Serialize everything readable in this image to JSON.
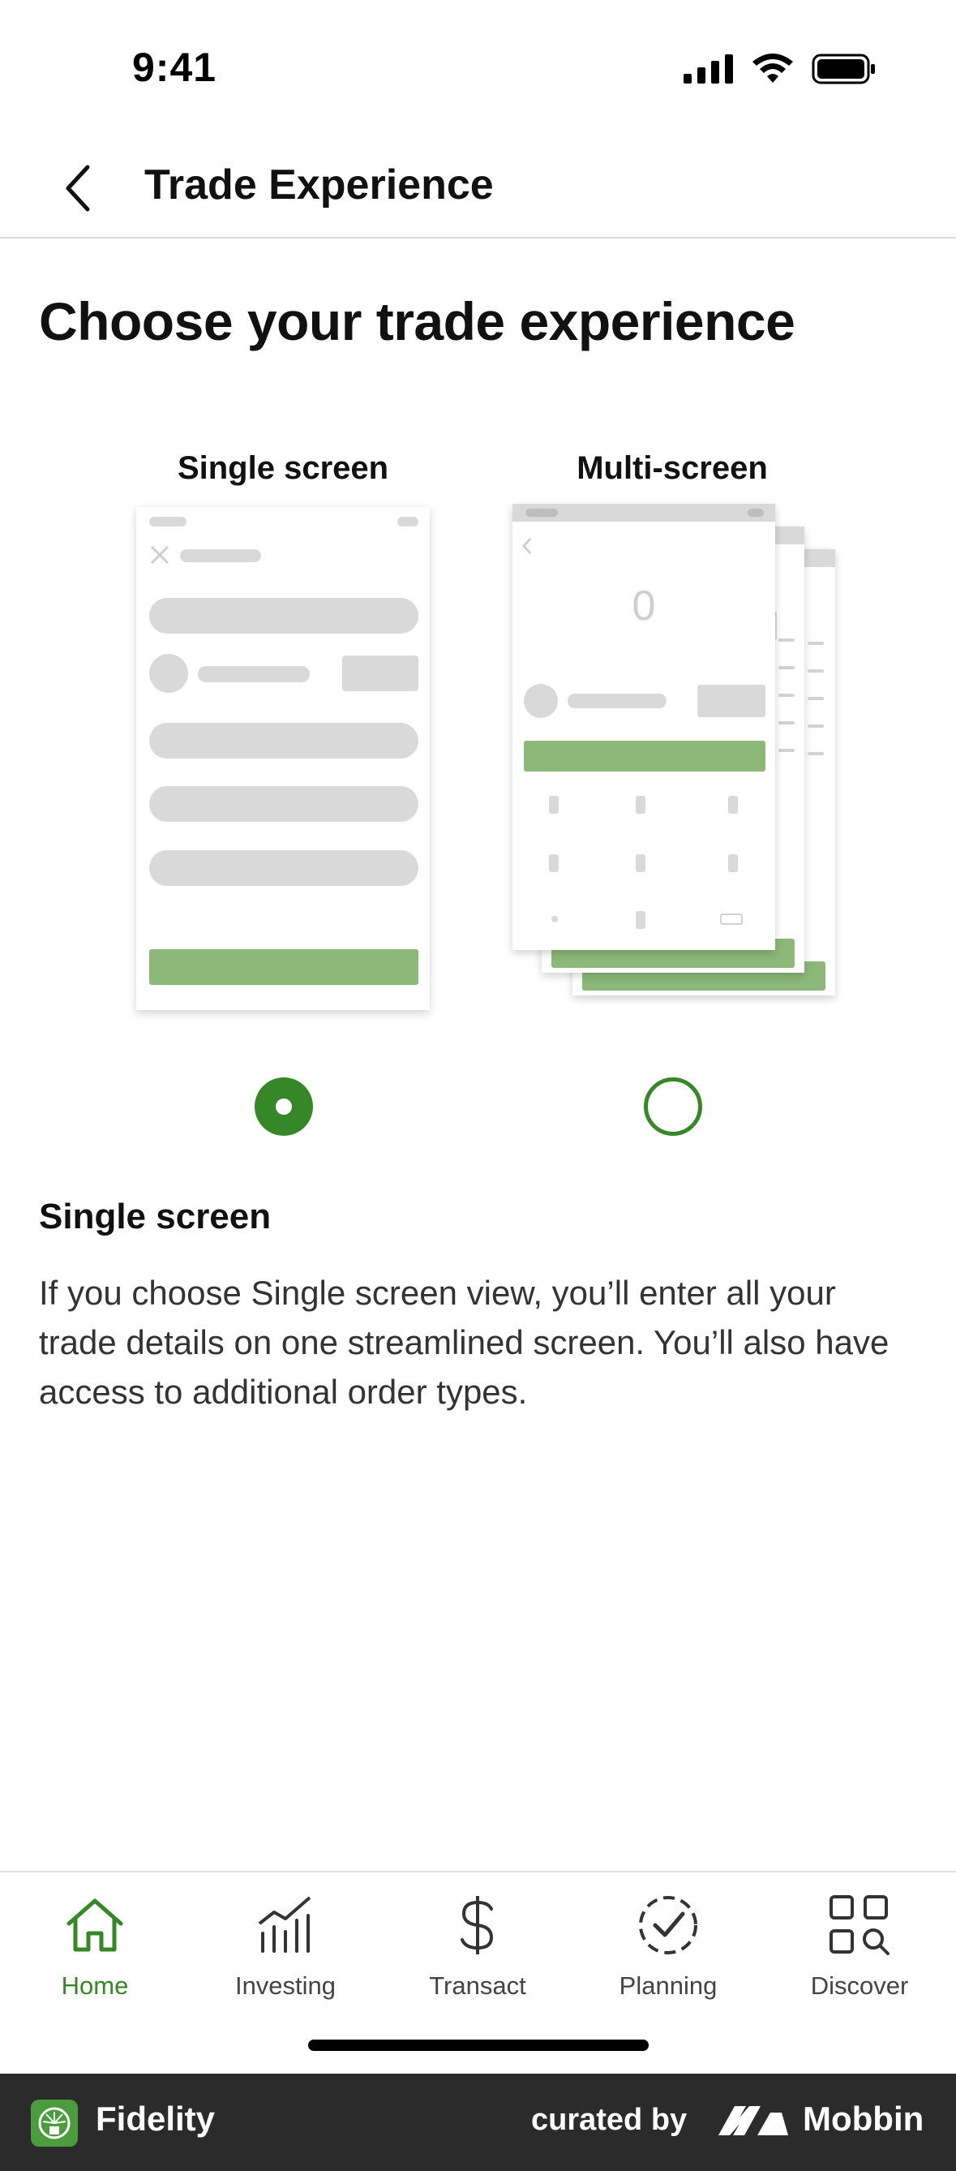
{
  "status_bar": {
    "time": "9:41"
  },
  "header": {
    "title": "Trade Experience"
  },
  "page": {
    "title": "Choose your trade experience"
  },
  "options": [
    {
      "label": "Single screen",
      "selected": true
    },
    {
      "label": "Multi-screen",
      "selected": false
    }
  ],
  "multi_illustration": {
    "amount": "0"
  },
  "description": {
    "title": "Single screen",
    "text": "If you choose Single screen view, you’ll enter all your trade details on one streamlined screen. You’ll also have access to additional order types."
  },
  "nav": {
    "items": [
      {
        "label": "Home",
        "icon": "home-icon",
        "active": true
      },
      {
        "label": "Investing",
        "icon": "chart-icon",
        "active": false
      },
      {
        "label": "Transact",
        "icon": "dollar-icon",
        "active": false
      },
      {
        "label": "Planning",
        "icon": "checkmark-circle-icon",
        "active": false
      },
      {
        "label": "Discover",
        "icon": "grid-search-icon",
        "active": false
      }
    ]
  },
  "footer": {
    "brand": "Fidelity",
    "curated_by": "curated by",
    "source": "Mobbin"
  },
  "colors": {
    "accent": "#368727",
    "illustration_green": "#8cb87a",
    "placeholder_gray": "#d9d9d9"
  }
}
